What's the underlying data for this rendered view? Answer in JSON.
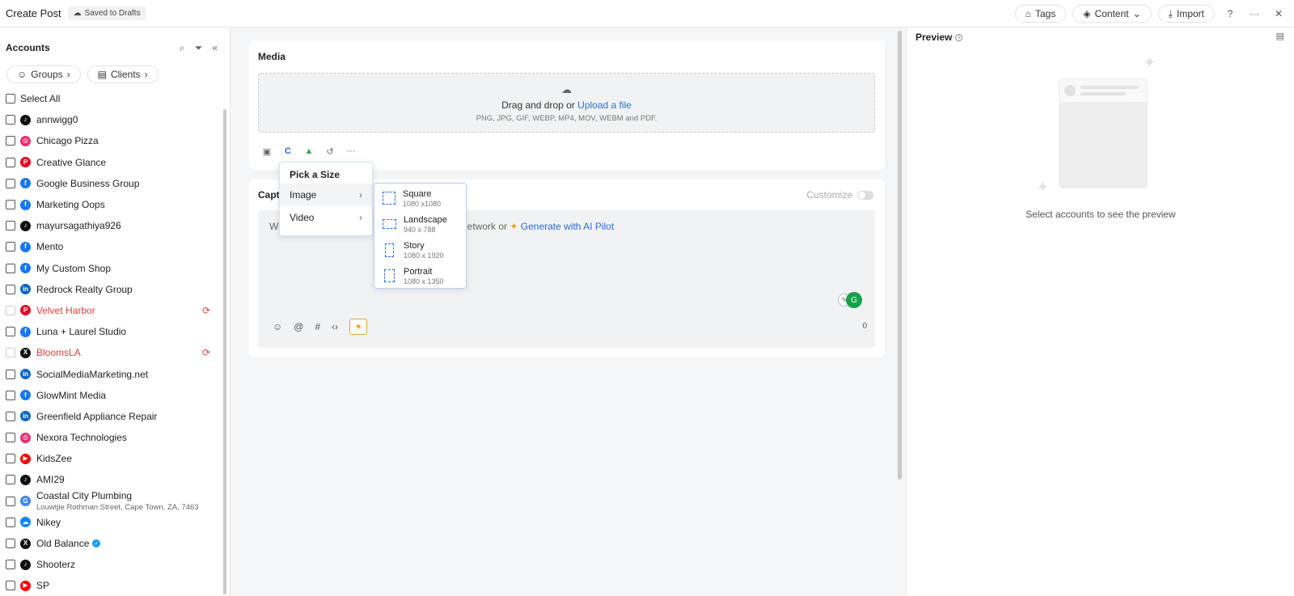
{
  "header": {
    "title": "Create Post",
    "drafts_badge": "Saved to Drafts",
    "tags_label": "Tags",
    "content_label": "Content",
    "import_label": "Import"
  },
  "sidebar": {
    "title": "Accounts",
    "groups_label": "Groups",
    "clients_label": "Clients",
    "select_all": "Select All",
    "accounts": [
      {
        "name": "annwigg0",
        "platform": "tiktok",
        "color": "#111111",
        "glyph": "♪"
      },
      {
        "name": "Chicago Pizza",
        "platform": "instagram",
        "color": "#e1306c",
        "glyph": "◎"
      },
      {
        "name": "Creative Glance",
        "platform": "pinterest",
        "color": "#e60023",
        "glyph": "P"
      },
      {
        "name": "Google Business Group",
        "platform": "facebook",
        "color": "#1877f2",
        "glyph": "f"
      },
      {
        "name": "Marketing Oops",
        "platform": "facebook",
        "color": "#1877f2",
        "glyph": "f"
      },
      {
        "name": "mayursagathiya926",
        "platform": "tiktok",
        "color": "#111111",
        "glyph": "♪"
      },
      {
        "name": "Mento",
        "platform": "facebook",
        "color": "#1877f2",
        "glyph": "f"
      },
      {
        "name": "My Custom Shop",
        "platform": "facebook",
        "color": "#1877f2",
        "glyph": "f"
      },
      {
        "name": "Redrock Realty Group",
        "platform": "linkedin",
        "color": "#0a66c2",
        "glyph": "in"
      },
      {
        "name": "Velvet Harbor",
        "platform": "pinterest",
        "color": "#e60023",
        "glyph": "P",
        "error": true
      },
      {
        "name": "Luna + Laurel Studio",
        "platform": "facebook",
        "color": "#1877f2",
        "glyph": "f"
      },
      {
        "name": "BloomsLA",
        "platform": "x",
        "color": "#111111",
        "glyph": "X",
        "error": true
      },
      {
        "name": "SocialMediaMarketing.net",
        "platform": "linkedin",
        "color": "#0a66c2",
        "glyph": "in"
      },
      {
        "name": "GlowMint Media",
        "platform": "facebook",
        "color": "#1877f2",
        "glyph": "f"
      },
      {
        "name": "Greenfield Appliance Repair",
        "platform": "linkedin",
        "color": "#0a66c2",
        "glyph": "in"
      },
      {
        "name": "Nexora Technologies",
        "platform": "instagram",
        "color": "#e1306c",
        "glyph": "◎"
      },
      {
        "name": "KidsZee",
        "platform": "youtube",
        "color": "#ff0000",
        "glyph": "▶"
      },
      {
        "name": "AMI29",
        "platform": "tiktok",
        "color": "#111111",
        "glyph": "♪"
      },
      {
        "name": "Coastal City Plumbing",
        "platform": "google",
        "color": "#4285f4",
        "glyph": "G",
        "sub": "Louwtjie Rothman Street, Cape Town, ZA, 7463"
      },
      {
        "name": "Nikey",
        "platform": "bluesky",
        "color": "#1185fe",
        "glyph": "☁"
      },
      {
        "name": "Old Balance",
        "platform": "x",
        "color": "#111111",
        "glyph": "X",
        "verified": true
      },
      {
        "name": "Shooterz",
        "platform": "tiktok",
        "color": "#111111",
        "glyph": "♪"
      },
      {
        "name": "SP",
        "platform": "youtube",
        "color": "#ff0000",
        "glyph": "▶"
      }
    ]
  },
  "media": {
    "title": "Media",
    "drop_text": "Drag and drop or ",
    "upload_link": "Upload a file",
    "formats": "PNG, JPG, GIF, WEBP, MP4, MOV, WEBM and PDF."
  },
  "size_menu": {
    "header": "Pick a Size",
    "items": [
      {
        "label": "Image"
      },
      {
        "label": "Video"
      }
    ]
  },
  "size_submenu": [
    {
      "name": "Square",
      "dims": "1080 x1080"
    },
    {
      "name": "Landscape",
      "dims": "940 x 788"
    },
    {
      "name": "Story",
      "dims": "1080 x 1920"
    },
    {
      "name": "Portrait",
      "dims": "1080 x 1350"
    }
  ],
  "caption": {
    "title_partial": "Capti",
    "placeholder_start": "Wr",
    "placeholder_end": "l network or ",
    "ai_link": "Generate with AI Pilot",
    "customize_label": "Customize",
    "char_count": "0"
  },
  "preview": {
    "title": "Preview",
    "empty_text": "Select accounts to see the preview"
  }
}
